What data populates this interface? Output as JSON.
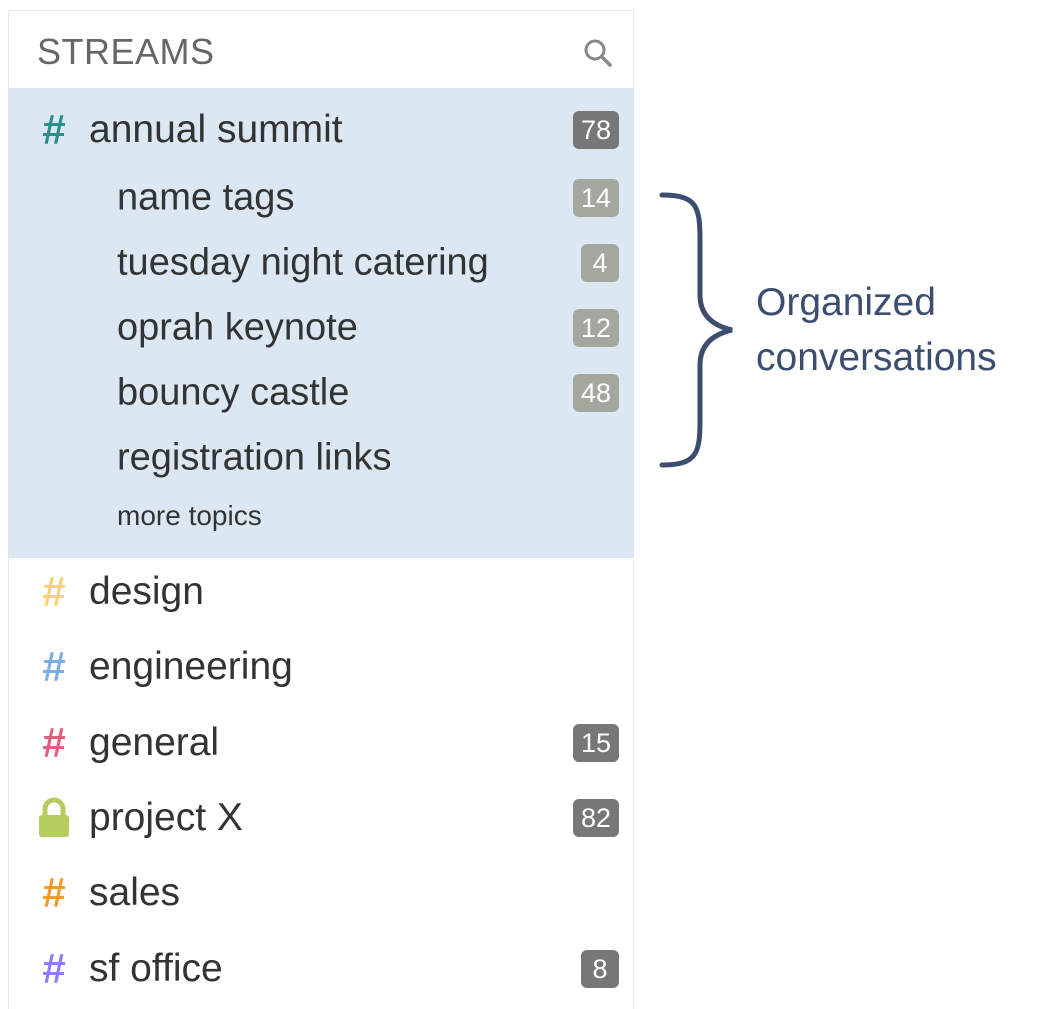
{
  "sidebar": {
    "title": "STREAMS",
    "search_icon": "search-icon",
    "active_stream": {
      "name": "annual summit",
      "icon": "hash-icon",
      "color": "#2a8f8a",
      "unread": "78",
      "topics": [
        {
          "name": "name tags",
          "unread": "14"
        },
        {
          "name": "tuesday night catering",
          "unread": "4"
        },
        {
          "name": "oprah keynote",
          "unread": "12"
        },
        {
          "name": "bouncy castle",
          "unread": "48"
        },
        {
          "name": "registration links",
          "unread": ""
        }
      ],
      "more_topics_label": "more topics"
    },
    "streams": [
      {
        "name": "design",
        "icon": "hash-icon",
        "color": "#f8d46b",
        "unread": ""
      },
      {
        "name": "engineering",
        "icon": "hash-icon",
        "color": "#79afe3",
        "unread": ""
      },
      {
        "name": "general",
        "icon": "hash-icon",
        "color": "#e0607e",
        "unread": "15"
      },
      {
        "name": "project X",
        "icon": "lock-icon",
        "color": "#b5cc5e",
        "unread": "82"
      },
      {
        "name": "sales",
        "icon": "hash-icon",
        "color": "#f69b2a",
        "unread": ""
      },
      {
        "name": "sf office",
        "icon": "hash-icon",
        "color": "#8e7cf5",
        "unread": "8"
      }
    ]
  },
  "annotation": {
    "line1": "Organized",
    "line2": "conversations",
    "color": "#3c4e70"
  },
  "colors": {
    "highlight_background": "#dbe8f3",
    "badge_dark": "#777777",
    "badge_light": "#a3a89f"
  }
}
